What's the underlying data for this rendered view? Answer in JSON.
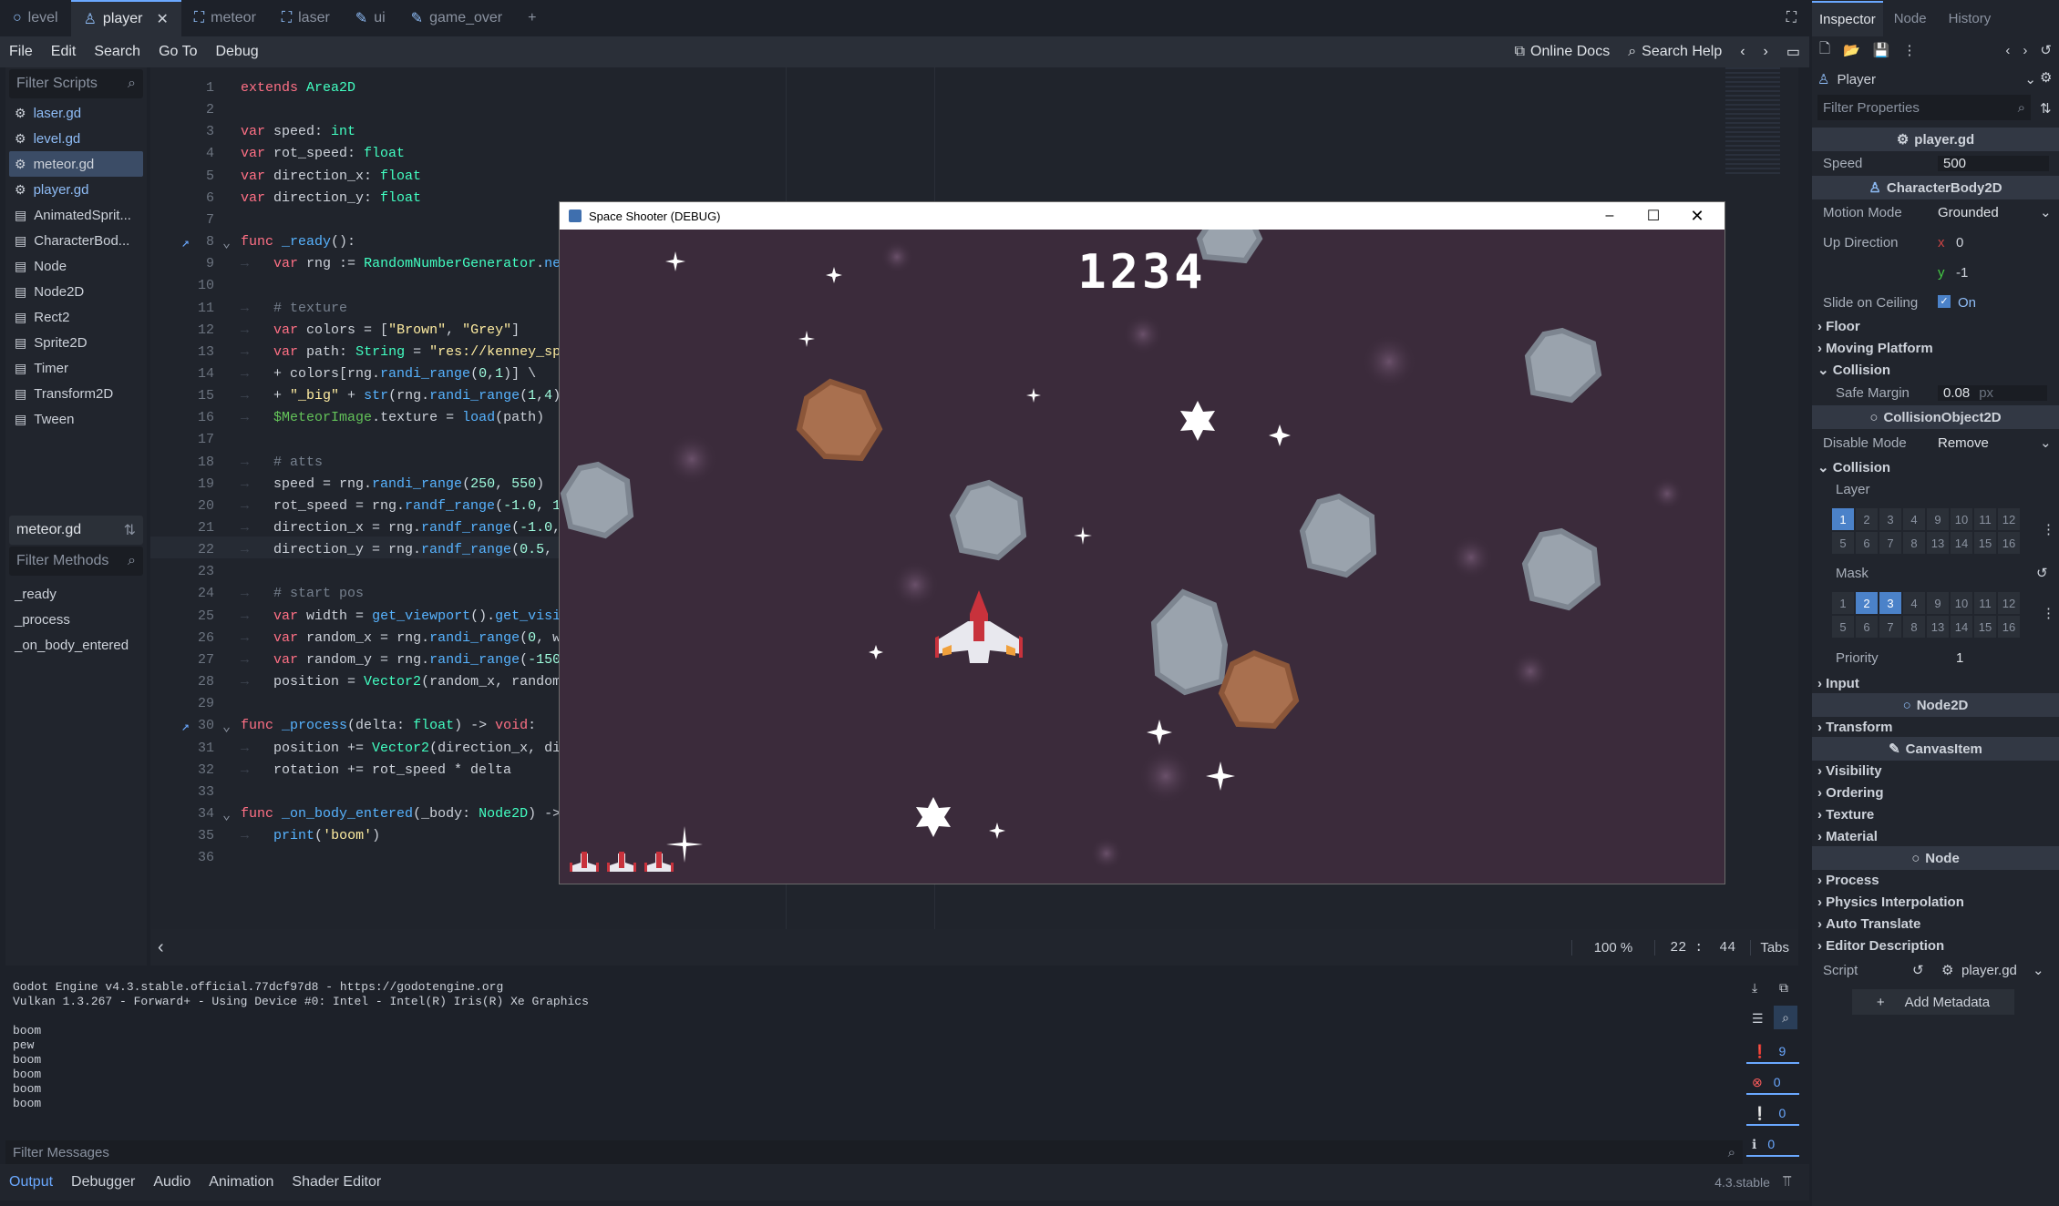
{
  "tabs": [
    {
      "label": "level",
      "icon": "circle-icon",
      "active": false
    },
    {
      "label": "player",
      "icon": "person-icon",
      "active": true
    },
    {
      "label": "meteor",
      "icon": "scene-icon",
      "active": false
    },
    {
      "label": "laser",
      "icon": "scene-icon",
      "active": false
    },
    {
      "label": "ui",
      "icon": "pencil-icon",
      "active": false
    },
    {
      "label": "game_over",
      "icon": "pencil-icon",
      "active": false
    }
  ],
  "menu": {
    "file": "File",
    "edit": "Edit",
    "search": "Search",
    "goto": "Go To",
    "debug": "Debug",
    "online_docs": "Online Docs",
    "search_help": "Search Help"
  },
  "scripts": {
    "filter_placeholder": "Filter Scripts",
    "items": [
      {
        "label": "laser.gd",
        "icon": "gear-icon",
        "style": "blue"
      },
      {
        "label": "level.gd",
        "icon": "gear-icon",
        "style": "blue"
      },
      {
        "label": "meteor.gd",
        "icon": "gear-icon",
        "style": "sel"
      },
      {
        "label": "player.gd",
        "icon": "gear-icon",
        "style": "blue"
      },
      {
        "label": "AnimatedSprit...",
        "icon": "doc-icon",
        "style": ""
      },
      {
        "label": "CharacterBod...",
        "icon": "doc-icon",
        "style": ""
      },
      {
        "label": "Node",
        "icon": "doc-icon",
        "style": ""
      },
      {
        "label": "Node2D",
        "icon": "doc-icon",
        "style": ""
      },
      {
        "label": "Rect2",
        "icon": "doc-icon",
        "style": ""
      },
      {
        "label": "Sprite2D",
        "icon": "doc-icon",
        "style": ""
      },
      {
        "label": "Timer",
        "icon": "doc-icon",
        "style": ""
      },
      {
        "label": "Transform2D",
        "icon": "doc-icon",
        "style": ""
      },
      {
        "label": "Tween",
        "icon": "doc-icon",
        "style": ""
      }
    ],
    "current": "meteor.gd",
    "methods_placeholder": "Filter Methods",
    "methods": [
      "_ready",
      "_process",
      "_on_body_entered"
    ]
  },
  "code_lines": [
    "<span class='kw'>extends</span> <span class='ty'>Area2D</span>",
    "",
    "<span class='kw'>var</span> speed: <span class='ty'>int</span>",
    "<span class='kw'>var</span> rot_speed: <span class='ty'>float</span>",
    "<span class='kw'>var</span> direction_x: <span class='ty'>float</span>",
    "<span class='kw'>var</span> direction_y: <span class='ty'>float</span>",
    "",
    "<span class='kw'>func</span> <span class='fn'>_ready</span>():",
    "    <span class='kw'>var</span> rng := <span class='ty'>RandomNumberGenerator</span>.<span class='fn'>new</span>()",
    "",
    "    <span class='cm'># texture</span>",
    "    <span class='kw'>var</span> colors = [<span class='st'>\"Brown\"</span>, <span class='st'>\"Grey\"</span>]",
    "    <span class='kw'>var</span> path: <span class='ty'>String</span> = <span class='st'>\"res://kenney_space</span>",
    "    + colors[rng.<span class='fn'>randi_range</span>(<span class='nm'>0</span>,<span class='nm'>1</span>)] \\",
    "    + <span class='st'>\"_big\"</span> + <span class='fn'>str</span>(rng.<span class='fn'>randi_range</span>(<span class='nm'>1</span>,<span class='nm'>4</span>)) +",
    "    <span class='nd'>$MeteorImage</span>.texture = <span class='fn'>load</span>(path)",
    "",
    "    <span class='cm'># atts</span>",
    "    speed = rng.<span class='fn'>randi_range</span>(<span class='nm'>250</span>, <span class='nm'>550</span>)",
    "    rot_speed = rng.<span class='fn'>randf_range</span>(<span class='nm'>-1.0</span>, <span class='nm'>1.0</span>)",
    "    direction_x = rng.<span class='fn'>randf_range</span>(<span class='nm'>-1.0</span>, <span class='nm'>1.</span>",
    "    direction_y = rng.<span class='fn'>randf_range</span>(<span class='nm'>0.5</span>, <span class='nm'>1.0</span>",
    "",
    "    <span class='cm'># start pos</span>",
    "    <span class='kw'>var</span> width = <span class='fn'>get_viewport</span>().<span class='fn'>get_visible</span>",
    "    <span class='kw'>var</span> random_x = rng.<span class='fn'>randi_range</span>(<span class='nm'>0</span>, widt",
    "    <span class='kw'>var</span> random_y = rng.<span class='fn'>randi_range</span>(<span class='nm'>-150</span>, -",
    "    position = <span class='ty'>Vector2</span>(random_x, random_y)",
    "",
    "<span class='kw'>func</span> <span class='fn'>_process</span>(delta: <span class='ty'>float</span>) -> <span class='kw'>void</span>:",
    "    position += <span class='ty'>Vector2</span>(direction_x, direc",
    "    rotation += rot_speed * delta",
    "",
    "<span class='kw'>func</span> <span class='fn'>_on_body_entered</span>(_body: <span class='ty'>Node2D</span>) -> <span class='kw'>vo</span>",
    "    <span class='fn'>print</span>(<span class='st'>'boom'</span>)",
    ""
  ],
  "editor_status": {
    "zoom": "100 %",
    "line": "22",
    "col": "44",
    "indent": "Tabs"
  },
  "game": {
    "title": "Space Shooter (DEBUG)",
    "score": "1234",
    "lives": 3
  },
  "output_lines": [
    "Godot Engine v4.3.stable.official.77dcf97d8 - https://godotengine.org",
    "Vulkan 1.3.267 - Forward+ - Using Device #0: Intel - Intel(R) Iris(R) Xe Graphics",
    "",
    "boom",
    "pew",
    "boom",
    "boom",
    "boom",
    "boom"
  ],
  "output_counts": {
    "messages": "9",
    "errors": "0",
    "warnings": "0",
    "info": "0"
  },
  "filter_messages": "Filter Messages",
  "bottom_tabs": [
    "Output",
    "Debugger",
    "Audio",
    "Animation",
    "Shader Editor"
  ],
  "version": "4.3.stable",
  "inspector": {
    "tabs": [
      "Inspector",
      "Node",
      "History"
    ],
    "node_name": "Player",
    "filter_placeholder": "Filter Properties",
    "script_header": "player.gd",
    "speed_label": "Speed",
    "speed_value": "500",
    "characterbody": "CharacterBody2D",
    "motion_mode_label": "Motion Mode",
    "motion_mode_value": "Grounded",
    "up_direction_label": "Up Direction",
    "up_x": "0",
    "up_y": "-1",
    "slide_label": "Slide on Ceiling",
    "slide_value": "On",
    "floor": "Floor",
    "moving_platform": "Moving Platform",
    "collision": "Collision",
    "safe_margin_label": "Safe Margin",
    "safe_margin_value": "0.08",
    "safe_margin_unit": "px",
    "collision_object": "CollisionObject2D",
    "disable_mode_label": "Disable Mode",
    "disable_mode_value": "Remove",
    "collision2": "Collision",
    "layer_label": "Layer",
    "mask_label": "Mask",
    "layer_bits": [
      "1",
      "2",
      "3",
      "4",
      "9",
      "10",
      "11",
      "12",
      "5",
      "6",
      "7",
      "8",
      "13",
      "14",
      "15",
      "16"
    ],
    "layer_on": [
      "1"
    ],
    "mask_on": [
      "2",
      "3"
    ],
    "priority_label": "Priority",
    "priority_value": "1",
    "input": "Input",
    "node2d": "Node2D",
    "transform": "Transform",
    "canvasitem": "CanvasItem",
    "visibility": "Visibility",
    "ordering": "Ordering",
    "texture": "Texture",
    "material": "Material",
    "node": "Node",
    "process": "Process",
    "physics_interp": "Physics Interpolation",
    "auto_translate": "Auto Translate",
    "editor_desc": "Editor Description",
    "script_label": "Script",
    "script_value": "player.gd",
    "add_metadata": "Add Metadata"
  }
}
